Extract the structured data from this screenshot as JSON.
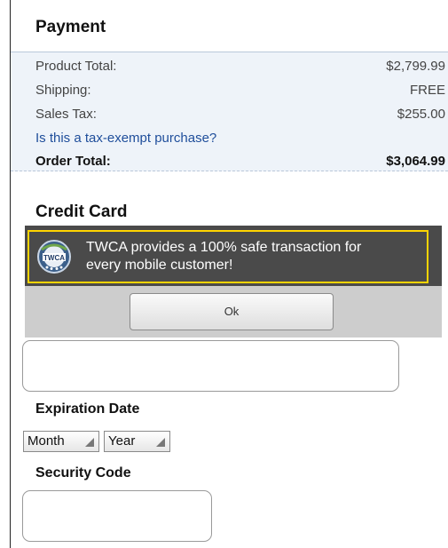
{
  "payment": {
    "title": "Payment",
    "rows": [
      {
        "label": "Product Total:",
        "value": "$2,799.99"
      },
      {
        "label": "Shipping:",
        "value": "FREE"
      },
      {
        "label": "Sales Tax:",
        "value": "$255.00"
      }
    ],
    "tax_exempt_link": "Is this a tax-exempt purchase?",
    "total": {
      "label": "Order Total:",
      "value": "$3,064.99"
    }
  },
  "credit_card": {
    "title": "Credit Card",
    "card_number_value": "",
    "expiration_label": "Expiration Date",
    "month_value": "Month",
    "year_value": "Year",
    "security_label": "Security Code",
    "security_value": ""
  },
  "dialog": {
    "logo_text": "TWCA",
    "message_line1": "TWCA provides a 100% safe transaction for",
    "message_line2": "every mobile customer!",
    "ok_label": "Ok"
  },
  "colors": {
    "link": "#1f4e9b",
    "dialog_bg": "#4a4a4a",
    "highlight": "#ffd400",
    "summary_bg": "#eef3f9"
  },
  "icons": {
    "dialog_logo": "twca-seal-icon",
    "select_arrow": "dropdown-triangle-icon"
  }
}
